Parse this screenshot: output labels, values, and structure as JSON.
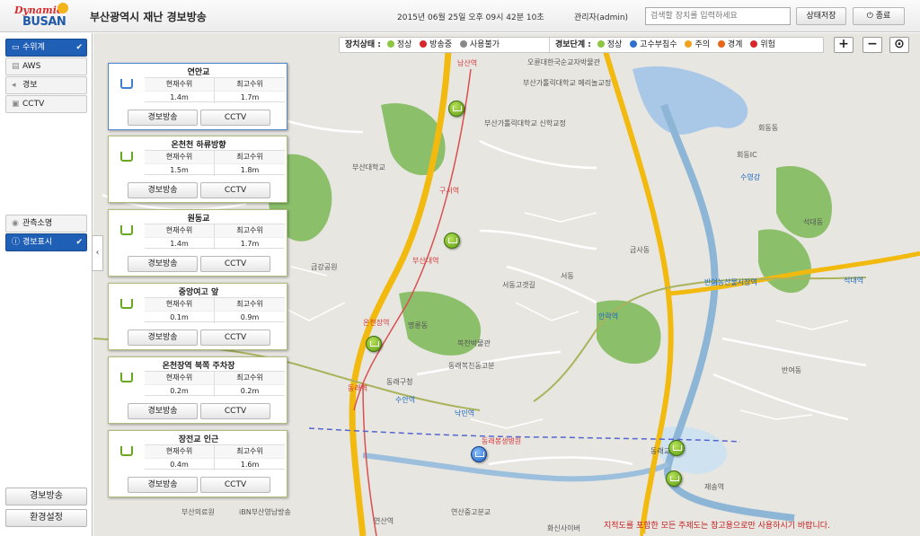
{
  "header": {
    "logo_top": "Dynamic",
    "logo_bottom": "BUSAN",
    "title": "부산광역시 재난 경보방송",
    "datetime": "2015년 06월 25일 오후 09시 42분 10초",
    "user": "관리자(admin)",
    "search_placeholder": "검색할 장치를 입력하세요",
    "save_label": "상태저장",
    "exit_label": "종료"
  },
  "sidebar": {
    "layers": [
      {
        "label": "수위계",
        "icon": "water-gauge-icon",
        "active": true
      },
      {
        "label": "AWS",
        "icon": "weather-station-icon",
        "active": false
      },
      {
        "label": "경보",
        "icon": "speaker-icon",
        "active": false
      },
      {
        "label": "CCTV",
        "icon": "camera-icon",
        "active": false
      }
    ],
    "modes": [
      {
        "label": "관측소명",
        "icon": "eye-icon",
        "active": false
      },
      {
        "label": "경보표시",
        "icon": "info-icon",
        "active": true
      }
    ],
    "bottom_buttons": [
      "경보방송",
      "환경설정"
    ]
  },
  "legend": {
    "device_title": "장치상태 :",
    "device_items": [
      {
        "label": "정상",
        "color": "#8cc63f"
      },
      {
        "label": "방송중",
        "color": "#d8262c"
      },
      {
        "label": "사용불가",
        "color": "#888888"
      }
    ],
    "alert_title": "경보단계 :",
    "alert_items": [
      {
        "label": "정상",
        "color": "#8cc63f"
      },
      {
        "label": "고수부침수",
        "color": "#2e6fd1"
      },
      {
        "label": "주의",
        "color": "#f0a21c"
      },
      {
        "label": "경계",
        "color": "#e8661c"
      },
      {
        "label": "위험",
        "color": "#d8262c"
      }
    ]
  },
  "map_controls": {
    "zoom_in": "+",
    "zoom_out": "−",
    "locate": "⊙"
  },
  "stations": [
    {
      "name": "연안교",
      "col1": "현재수위",
      "col2": "최고수위",
      "current": "1.4m",
      "max": "1.7m",
      "btn1": "경보방송",
      "btn2": "CCTV"
    },
    {
      "name": "온천천 하류방향",
      "col1": "현재수위",
      "col2": "최고수위",
      "current": "1.5m",
      "max": "1.8m",
      "btn1": "경보방송",
      "btn2": "CCTV"
    },
    {
      "name": "원동교",
      "col1": "현재수위",
      "col2": "최고수위",
      "current": "1.4m",
      "max": "1.7m",
      "btn1": "경보방송",
      "btn2": "CCTV"
    },
    {
      "name": "중앙여고 앞",
      "col1": "현재수위",
      "col2": "최고수위",
      "current": "0.1m",
      "max": "0.9m",
      "btn1": "경보방송",
      "btn2": "CCTV"
    },
    {
      "name": "온천장역 북쪽 주차장",
      "col1": "현재수위",
      "col2": "최고수위",
      "current": "0.2m",
      "max": "0.2m",
      "btn1": "경보방송",
      "btn2": "CCTV"
    },
    {
      "name": "장전교 인근",
      "col1": "현재수위",
      "col2": "최고수위",
      "current": "0.4m",
      "max": "1.6m",
      "btn1": "경보방송",
      "btn2": "CCTV"
    }
  ],
  "map_labels": [
    "오륜대한국순교자박물관",
    "부산가톨릭대학교 메리놀교정",
    "부산가톨릭대학교 신학교정",
    "부산대학교",
    "금강공원",
    "서동고갯길",
    "동래구청",
    "복천박물관",
    "동래복천동고분",
    "수안역",
    "낙민역",
    "동래역",
    "온천장역",
    "부산대역",
    "구서역",
    "남산역",
    "서동",
    "금사동",
    "동래봉생병원",
    "부산의료원",
    "iBN부산영남방송",
    "연산중고분교",
    "화신사이버",
    "안락역",
    "반여동",
    "회동동",
    "석대동",
    "수영강",
    "재송역",
    "명륜동",
    "동래교",
    "반여농산물시장역",
    "석대역",
    "회동IC",
    "연산역"
  ],
  "disclaimer": "지적도를 포함한 모든 주제도는 참고용으로만 사용하시기 바랍니다."
}
